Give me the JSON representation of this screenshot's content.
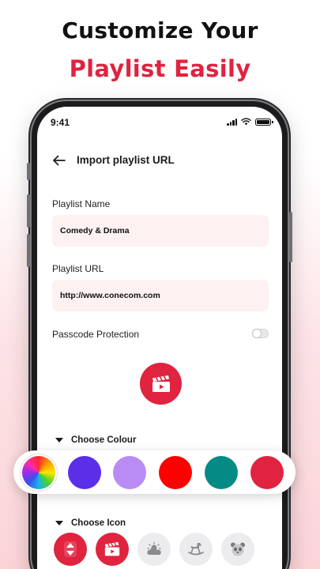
{
  "headline": {
    "line1": "Customize Your",
    "line2": "Playlist Easily"
  },
  "status_bar": {
    "time": "9:41"
  },
  "header": {
    "title": "Import playlist URL"
  },
  "form": {
    "name_label": "Playlist Name",
    "name_value": "Comedy & Drama",
    "url_label": "Playlist URL",
    "url_value": "http://www.conecom.com",
    "passcode_label": "Passcode Protection",
    "passcode_enabled": false
  },
  "colour_section": {
    "label": "Choose Colour",
    "swatches": [
      "multicolor-wheel",
      "#5b2ee8",
      "#b98cf5",
      "#ff0000",
      "#058b86",
      "#e0233f"
    ]
  },
  "icon_section": {
    "label": "Choose Icon",
    "icons": [
      "sort-arrows-icon",
      "clapperboard-icon",
      "cloud-sun-icon",
      "rocking-horse-icon",
      "panda-icon"
    ]
  },
  "colors": {
    "accent": "#e0233f",
    "field_bg": "#fdf1f2"
  }
}
